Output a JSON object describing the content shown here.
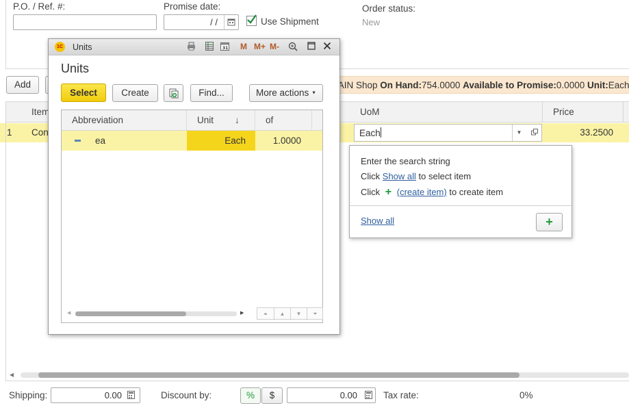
{
  "form": {
    "po_label": "P.O. / Ref. #:",
    "po_value": "",
    "promise_label": "Promise date:",
    "promise_value": "  /  /",
    "use_shipment_label": "Use Shipment",
    "use_shipment_checked": true,
    "order_status_label": "Order status:",
    "order_status_value": "New"
  },
  "toolbar": {
    "add_label": "Add"
  },
  "availability": {
    "text_prefix": "IAIN Shop ",
    "on_hand_label": "On Hand:",
    "on_hand_value": "754.0000",
    "available_label": "Available to Promise:",
    "available_value": "0.0000",
    "unit_label": "Unit:",
    "unit_value": "Each"
  },
  "lines_table": {
    "columns": [
      "Item",
      "UoM",
      "Price"
    ],
    "rows": [
      {
        "num": "1",
        "item": "Con",
        "uom": "Each",
        "price": "33.2500"
      }
    ]
  },
  "units_window": {
    "window_title": "Units",
    "heading": "Units",
    "select_label": "Select",
    "create_label": "Create",
    "find_label": "Find...",
    "more_actions_label": "More actions",
    "columns": [
      "Abbreviation",
      "Unit",
      "of"
    ],
    "sort_indicator": "↓",
    "rows": [
      {
        "abbreviation": "ea",
        "unit": "Each",
        "of": "1.0000"
      }
    ],
    "title_icons": [
      "print-icon",
      "spreadsheet-icon",
      "calendar-icon",
      "M",
      "M+",
      "M-",
      "zoom-icon",
      "maximize-icon",
      "close-icon"
    ]
  },
  "dropdown": {
    "line1": "Enter the search string",
    "line2_prefix": "Click ",
    "line2_link": "Show all",
    "line2_suffix": " to select item",
    "line3_prefix": "Click ",
    "line3_link": "(create item)",
    "line3_suffix": " to create item",
    "show_all_link": "Show all"
  },
  "footer": {
    "shipping_label": "Shipping:",
    "shipping_value": "0.00",
    "discount_label": "Discount by:",
    "percent_label": "%",
    "dollar_label": "$",
    "discount_value": "0.00",
    "tax_label": "Tax rate:",
    "tax_value": "0%"
  },
  "colors": {
    "accent_yellow": "#f5d51c",
    "row_highlight": "#faf3a6",
    "header_bar": "#fbe7cf",
    "link_blue": "#2f5f9e",
    "plus_green": "#1e9a3a"
  }
}
